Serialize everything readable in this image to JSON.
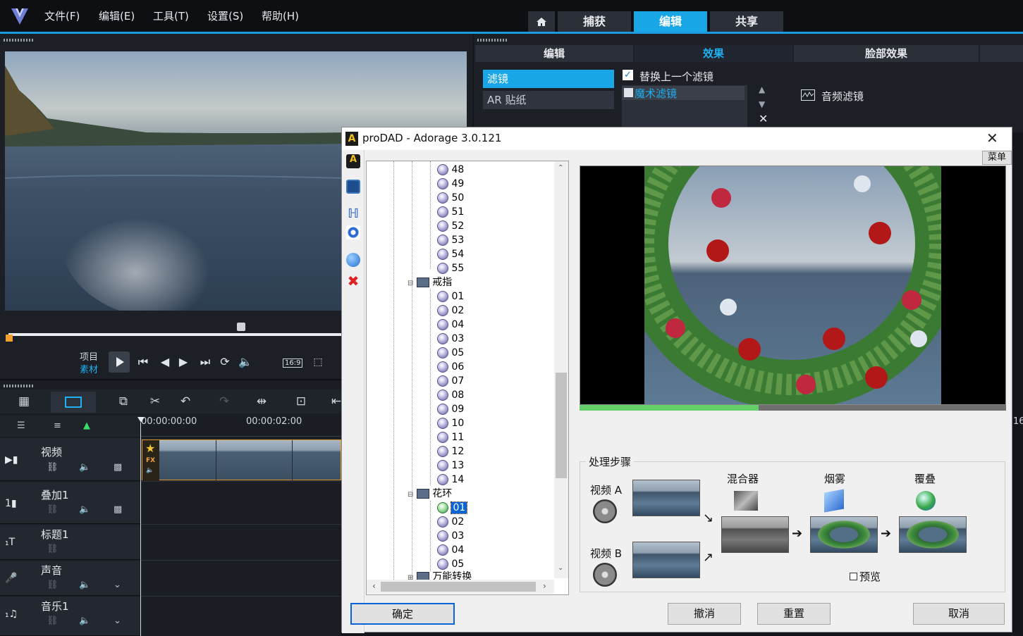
{
  "menubar": {
    "items": [
      "文件(F)",
      "编辑(E)",
      "工具(T)",
      "设置(S)",
      "帮助(H)"
    ],
    "tabs": [
      "捕获",
      "编辑",
      "共享"
    ],
    "active_tab": "编辑"
  },
  "preview": {
    "project_label": "项目",
    "clip_label": "素材",
    "aspect_label": "16:9"
  },
  "effects": {
    "tabs": [
      "编辑",
      "效果",
      "脸部效果"
    ],
    "active_tab": "效果",
    "categories": [
      "滤镜",
      "AR 贴纸"
    ],
    "replace_label": "替换上一个滤镜",
    "replace_checked": true,
    "filter_item": "魔术滤镜",
    "audio_filter_label": "音频滤镜"
  },
  "timeline": {
    "timecode_start": "00:00:00:00",
    "timecode_mark": "00:00:02:00",
    "tracks": [
      "视频",
      "叠加1",
      "标题1",
      "声音",
      "音乐1"
    ],
    "right_edge_number": "16"
  },
  "dialog": {
    "title": "proDAD - Adorage 3.0.121",
    "menu_button": "菜单",
    "tree": {
      "group1_items": [
        "48",
        "49",
        "50",
        "51",
        "52",
        "53",
        "54",
        "55"
      ],
      "group2_name": "戒指",
      "group2_items": [
        "01",
        "02",
        "04",
        "03",
        "05",
        "06",
        "07",
        "08",
        "09",
        "10",
        "11",
        "12",
        "13",
        "14"
      ],
      "group3_name": "花环",
      "group3_items": [
        "01",
        "02",
        "03",
        "04",
        "05"
      ],
      "selected_item": "01",
      "group4_name": "万能转换"
    },
    "process_steps_label": "处理步骤",
    "video_a_label": "视频 A",
    "video_b_label": "视频 B",
    "mixer_label": "混合器",
    "smoke_label": "烟雾",
    "overlay_label": "覆叠",
    "preview_checkbox": "预览",
    "buttons": {
      "ok": "确定",
      "undo": "撤消",
      "reset": "重置",
      "cancel": "取消"
    }
  }
}
